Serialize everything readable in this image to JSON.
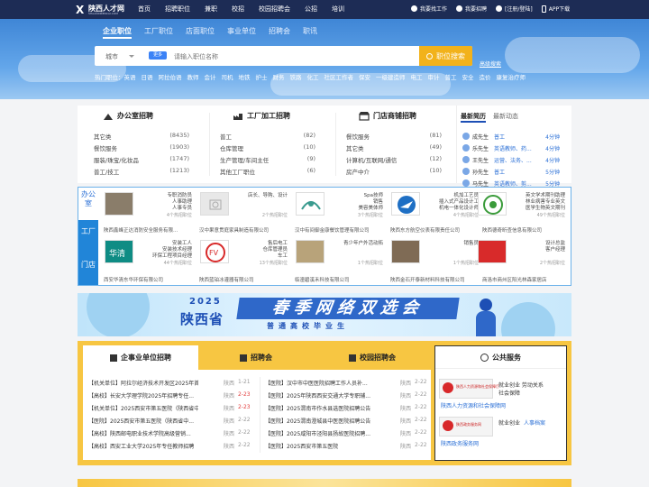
{
  "logo": {
    "mark": "X",
    "name": "陕西人才网",
    "sub": "SHAANXIRENCAI.COM"
  },
  "topnav": [
    "首页",
    "招聘职位",
    "兼职",
    "校招",
    "校园招聘会",
    "公招",
    "培训"
  ],
  "topright": {
    "find_job": "我要找工作",
    "recruit": "我要招聘",
    "login": "[注册/登陆]",
    "app": "APP下载"
  },
  "search_tabs": [
    "企业职位",
    "工厂职位",
    "店面职位",
    "事业单位",
    "招聘会",
    "职讯"
  ],
  "search": {
    "city": "城市",
    "new_tag": "更多",
    "placeholder": "请输入职位名称",
    "button": "职位搜索",
    "advanced": "高级搜索"
  },
  "hot": [
    "热门职位：英语",
    "日语",
    "阿拉伯语",
    "教师",
    "会计",
    "司机",
    "地铁",
    "护士",
    "财务",
    "铁路",
    "化工",
    "社区工作者",
    "保安",
    "一级建造师",
    "电工",
    "审计",
    "普工",
    "安全",
    "造价",
    "康复治疗师"
  ],
  "categories": [
    {
      "title": "办公室招聘",
      "items": [
        [
          "其它类",
          "(8435)"
        ],
        [
          "餐饮服务",
          "(1903)"
        ],
        [
          "服装/珠宝/化妆品",
          "(1747)"
        ],
        [
          "普工/技工",
          "(1213)"
        ]
      ]
    },
    {
      "title": "工厂加工招聘",
      "items": [
        [
          "普工",
          "(82)"
        ],
        [
          "仓库管理",
          "(10)"
        ],
        [
          "生产管理/车间主任",
          "(9)"
        ],
        [
          "其他工厂职位",
          "(6)"
        ]
      ]
    },
    {
      "title": "门店商铺招聘",
      "items": [
        [
          "餐饮服务",
          "(81)"
        ],
        [
          "其它类",
          "(49)"
        ],
        [
          "计算机/互联网/通信",
          "(12)"
        ],
        [
          "房产中介",
          "(10)"
        ]
      ]
    }
  ],
  "recent": {
    "tabs": [
      "最新简历",
      "最新动态"
    ],
    "rows": [
      [
        "成先生",
        "普工",
        "4分钟"
      ],
      [
        "乐先生",
        "英语教师、药...",
        "4分钟"
      ],
      [
        "王先生",
        "运营、法务、...",
        "4分钟"
      ],
      [
        "孙先生",
        "普工",
        "5分钟"
      ],
      [
        "马先生",
        "英语教师、剪...",
        "5分钟"
      ]
    ]
  },
  "comp_side": [
    "办公室",
    "工厂",
    "门店"
  ],
  "companies": [
    {
      "l1": "专职消防员",
      "l2": "人事助理",
      "l3": "人事专员",
      "cnt": "4个热招职位",
      "name": "陕西鑫峰正达消防安全服务有限..."
    },
    {
      "l1": "店长、导购、设计",
      "l2": "",
      "l3": "",
      "cnt": "2个热招职位",
      "name": "汉中果意贯庭家具制造有限公司"
    },
    {
      "l1": "Spa技师",
      "l2": "销售",
      "l3": "美容美体师",
      "cnt": "3个热招职位",
      "name": "汉中有间御金康餐饮管理有限公司"
    },
    {
      "l1": "机加工艺员",
      "l2": "插入式产品设计工",
      "l3": "机电一体化设计师",
      "cnt": "4个热招职位",
      "name": "陕西东方航空仪表有限责任公司"
    },
    {
      "l1": "英文学术期刊助理",
      "l2": "林业病害专业英文",
      "l3": "医学生物英文期刊",
      "cnt": "49个热招职位",
      "name": "陕西德奇昕查信息有限公司"
    },
    {
      "l1": "安装工人",
      "l2": "安装技术经理",
      "l3": "环保工程项目经理",
      "cnt": "44个热招职位",
      "name": "西安华清东华环保有限公司"
    },
    {
      "l1": "售后电工",
      "l2": "仓库管理员",
      "l3": "车工",
      "cnt": "13个热招职位",
      "name": "陕西蓝铂冰灌器有限公司"
    },
    {
      "l1": "青少年户外活动拓",
      "l2": "",
      "l3": "",
      "cnt": "1个热招职位",
      "name": "临潼碧溪禾科技有限公司"
    },
    {
      "l1": "销售员",
      "l2": "",
      "l3": "",
      "cnt": "1个热招职位",
      "name": "陕西金石开泰新材料科技有限公司"
    },
    {
      "l1": "设计总监",
      "l2": "客户经理",
      "l3": "",
      "cnt": "2个热招职位",
      "name": "商洛市商州区阳光林森家居店"
    }
  ],
  "banner": {
    "year": "2025",
    "prov": "陕西省",
    "main": "春季网络双选会",
    "sub": "普通高校毕业生"
  },
  "jobs_tabs": [
    "企事业单位招聘",
    "招聘会",
    "校园招聘会"
  ],
  "jobs_left": [
    [
      "【机关单位】阿拉尔经济技术开发区2025年首...",
      "陕西",
      "1-21"
    ],
    [
      "【高校】长安大学理学院2025年招聘专任...",
      "陕西",
      "2-23"
    ],
    [
      "【机关单位】2025西安市第五医院（陕西省中医...",
      "陕西",
      "2-23"
    ],
    [
      "【医院】2025西安市第五医院（陕西省中...",
      "陕西",
      "2-22"
    ],
    [
      "【高校】陕西邮电职业技术学院高级营销...",
      "陕西",
      "2-22"
    ],
    [
      "【高校】西安工业大学2025年专任教师招聘",
      "陕西",
      "2-22"
    ]
  ],
  "jobs_right": [
    [
      "【医院】汉中市中医医院招聘工作人员补...",
      "陕西",
      "2-22"
    ],
    [
      "【医院】2025年陕西西安交通大学专职辅...",
      "陕西",
      "2-22"
    ],
    [
      "【医院】2025渭南市作水县选医院招聘公告",
      "陕西",
      "2-22"
    ],
    [
      "【医院】2025渭南澄城县中医医院招聘公告",
      "陕西",
      "2-22"
    ],
    [
      "【医院】2025咸阳市泾阳县扬故医院招聘...",
      "陕西",
      "2-22"
    ],
    [
      "【医院】2025西安市第五医院",
      "陕西",
      "2-22"
    ]
  ],
  "public": {
    "title": "公共服务",
    "e1": "陕西人力资源和社会保障厅",
    "l1a": "就业创业  劳动关系",
    "l1b": "社会保障",
    "org1": "陕西人力资源和社会保障网",
    "e2": "陕西政务服务网",
    "l2a": "就业创业",
    "l2b": "人事档案",
    "org2": "陕西政务服务网"
  },
  "colors": {
    "navy": "#1d2c55",
    "blue": "#2185d8",
    "yellow": "#f7c642",
    "red": "#e23b3b"
  }
}
